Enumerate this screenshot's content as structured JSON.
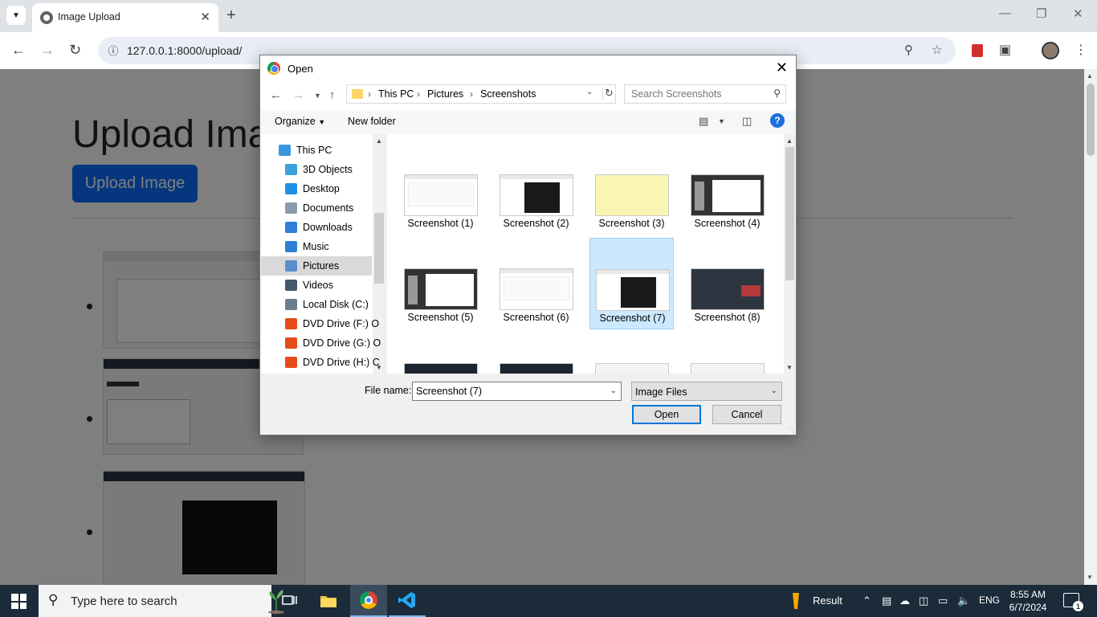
{
  "browser": {
    "tab_title": "Image Upload",
    "url": "127.0.0.1:8000/upload/"
  },
  "page": {
    "title": "Upload Ima",
    "upload_button": "Upload Image"
  },
  "dialog": {
    "title": "Open",
    "breadcrumb": [
      "This PC",
      "Pictures",
      "Screenshots"
    ],
    "search_placeholder": "Search Screenshots",
    "organize_label": "Organize",
    "new_folder_label": "New folder",
    "nav_items": [
      {
        "label": "This PC",
        "icon": "computer-icon",
        "color": "#3a96dd"
      },
      {
        "label": "3D Objects",
        "icon": "cube-icon",
        "color": "#3aa0d8"
      },
      {
        "label": "Desktop",
        "icon": "desktop-icon",
        "color": "#1e90e6"
      },
      {
        "label": "Documents",
        "icon": "document-icon",
        "color": "#8a9bb0"
      },
      {
        "label": "Downloads",
        "icon": "download-icon",
        "color": "#2f7fd6"
      },
      {
        "label": "Music",
        "icon": "music-icon",
        "color": "#2f7fd6"
      },
      {
        "label": "Pictures",
        "icon": "pictures-icon",
        "color": "#5b8fc9"
      },
      {
        "label": "Videos",
        "icon": "video-icon",
        "color": "#44576b"
      },
      {
        "label": "Local Disk (C:)",
        "icon": "disk-icon",
        "color": "#6b7d8f"
      },
      {
        "label": "DVD Drive (F:) O",
        "icon": "office-icon",
        "color": "#e64a19"
      },
      {
        "label": "DVD Drive (G:) O",
        "icon": "office-icon",
        "color": "#e64a19"
      },
      {
        "label": "DVD Drive (H:) C",
        "icon": "office-icon",
        "color": "#e64a19"
      }
    ],
    "selected_nav": "Pictures",
    "files": [
      {
        "label": "Screenshot (1)",
        "theme": "white"
      },
      {
        "label": "Screenshot (2)",
        "theme": "dark-center"
      },
      {
        "label": "Screenshot (3)",
        "theme": "yellow"
      },
      {
        "label": "Screenshot (4)",
        "theme": "dark-doc"
      },
      {
        "label": "Screenshot (5)",
        "theme": "dark-doc"
      },
      {
        "label": "Screenshot (6)",
        "theme": "white"
      },
      {
        "label": "Screenshot (7)",
        "theme": "dark-center"
      },
      {
        "label": "Screenshot (8)",
        "theme": "photo"
      }
    ],
    "selected_file": "Screenshot (7)",
    "file_name_label": "File name:",
    "file_name_value": "Screenshot (7)",
    "file_type": "Image Files",
    "open_button": "Open",
    "cancel_button": "Cancel"
  },
  "taskbar": {
    "search_placeholder": "Type here to search",
    "weather_label": "Result",
    "language": "ENG",
    "time": "8:55 AM",
    "date": "6/7/2024",
    "notification_count": "1"
  }
}
